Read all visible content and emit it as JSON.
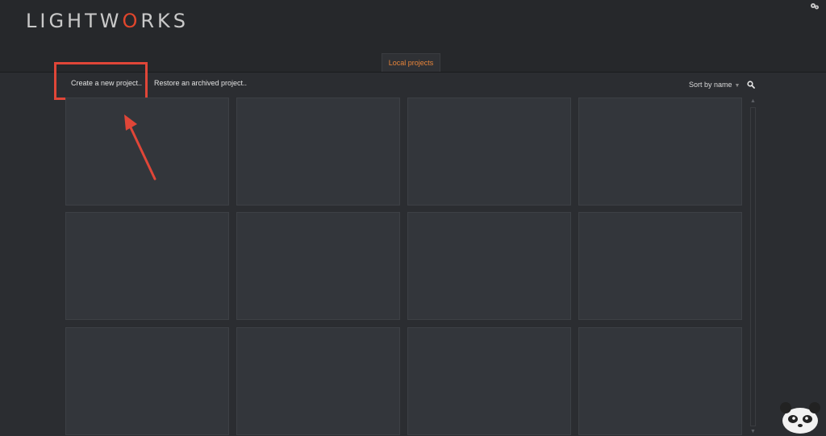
{
  "app": {
    "logo_prefix": "LIGHTW",
    "logo_accent": "O",
    "logo_suffix": "RKS"
  },
  "tabs": [
    {
      "label": "Local projects",
      "active": true
    }
  ],
  "toolbar": {
    "create_label": "Create a new project..",
    "restore_label": "Restore an archived project..",
    "sort_label": "Sort by name",
    "sort_caret": "▼"
  },
  "icons": {
    "search": "search-icon",
    "corner": "settings-icon",
    "mascot": "panda-icon"
  },
  "project_cards": [
    {
      "title": ""
    },
    {
      "title": ""
    },
    {
      "title": ""
    },
    {
      "title": ""
    },
    {
      "title": ""
    },
    {
      "title": ""
    },
    {
      "title": ""
    },
    {
      "title": ""
    },
    {
      "title": ""
    },
    {
      "title": ""
    },
    {
      "title": ""
    },
    {
      "title": ""
    }
  ],
  "colors": {
    "accent_orange": "#e8853a",
    "brand_red": "#e0462c",
    "annotation_red": "#e04638",
    "background": "#2b2d31"
  }
}
